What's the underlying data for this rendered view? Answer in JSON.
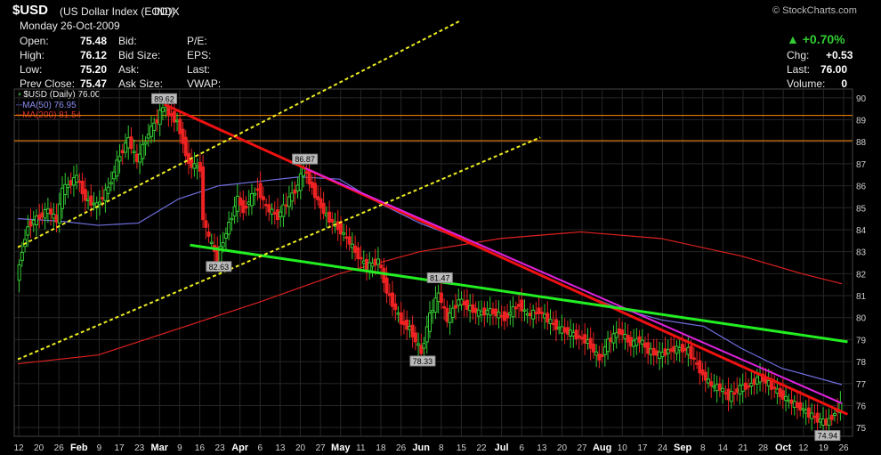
{
  "header": {
    "symbol": "$USD",
    "name": "(US Dollar Index (EOD))",
    "exchange": "INDX",
    "credit": "© StockCharts.com",
    "date": "Monday  26-Oct-2009",
    "open_label": "Open:",
    "open": "75.48",
    "high_label": "High:",
    "high": "76.12",
    "low_label": "Low:",
    "low": "75.20",
    "prevclose_label": "Prev Close:",
    "prevclose": "75.47",
    "bid_label": "Bid:",
    "bidsize_label": "Bid Size:",
    "ask_label": "Ask:",
    "asksize_label": "Ask Size:",
    "pe_label": "P/E:",
    "eps_label": "EPS:",
    "last_label": "Last:",
    "vwap_label": "VWAP:",
    "pct_change": "+0.70%",
    "chg_label": "Chg:",
    "chg": "+0.53",
    "last2_label": "Last:",
    "last2": "76.00",
    "volume_label": "Volume:",
    "volume": "0"
  },
  "legend": {
    "price": "$USD (Daily) 76.00",
    "ma50": "MA(50) 76.95",
    "ma200": "MA(200) 81.54"
  },
  "colors": {
    "up": "#33cc33",
    "down": "#ee2222",
    "ma50": "#6f6fe0",
    "ma200": "#dd2020",
    "grid": "#262626",
    "axis": "#cfcfcf",
    "trend_red": "#ee1111",
    "trend_magenta": "#dd22dd",
    "trend_green": "#22ee22",
    "trend_yellow": "#eeee22",
    "hline": "#ff8800"
  },
  "chart_data": {
    "type": "candlestick",
    "title": "$USD (US Dollar Index (EOD)) INDX",
    "xlabel": "",
    "ylabel": "",
    "ylim": [
      74.6,
      90.4
    ],
    "y_ticks": [
      75,
      76,
      77,
      78,
      79,
      80,
      81,
      82,
      83,
      84,
      85,
      86,
      87,
      88,
      89,
      90
    ],
    "x_ticks": [
      "12",
      "20",
      "26",
      "Feb",
      "9",
      "17",
      "23",
      "Mar",
      "9",
      "16",
      "23",
      "Apr",
      "6",
      "13",
      "20",
      "27",
      "May",
      "11",
      "18",
      "26",
      "Jun",
      "8",
      "15",
      "22",
      "Jul",
      "6",
      "13",
      "20",
      "27",
      "Aug",
      "10",
      "17",
      "24",
      "Sep",
      "8",
      "14",
      "21",
      "28",
      "Oct",
      "12",
      "19",
      "26"
    ],
    "price_points": [
      [
        "Jan 12",
        81.7
      ],
      [
        "Jan 14",
        83.1
      ],
      [
        "Jan 16",
        84.2
      ],
      [
        "Jan 20",
        84.6
      ],
      [
        "Jan 23",
        84.9
      ],
      [
        "Jan 26",
        84.4
      ],
      [
        "Jan 28",
        85.8
      ],
      [
        "Feb 2",
        86.4
      ],
      [
        "Feb 5",
        85.4
      ],
      [
        "Feb 9",
        85.1
      ],
      [
        "Feb 13",
        85.9
      ],
      [
        "Feb 17",
        87.4
      ],
      [
        "Feb 20",
        88.1
      ],
      [
        "Feb 23",
        87.1
      ],
      [
        "Feb 27",
        88.4
      ],
      [
        "Mar 2",
        89.0
      ],
      [
        "Mar 4",
        89.6
      ],
      [
        "Mar 6",
        89.3
      ],
      [
        "Mar 9",
        88.9
      ],
      [
        "Mar 11",
        88.0
      ],
      [
        "Mar 13",
        87.0
      ],
      [
        "Mar 17",
        86.8
      ],
      [
        "Mar 18",
        84.5
      ],
      [
        "Mar 20",
        83.6
      ],
      [
        "Mar 23",
        82.7
      ],
      [
        "Mar 26",
        83.9
      ],
      [
        "Mar 30",
        85.4
      ],
      [
        "Apr 1",
        84.9
      ],
      [
        "Apr 6",
        85.9
      ],
      [
        "Apr 9",
        85.0
      ],
      [
        "Apr 13",
        84.6
      ],
      [
        "Apr 16",
        85.2
      ],
      [
        "Apr 20",
        86.0
      ],
      [
        "Apr 22",
        86.8
      ],
      [
        "Apr 24",
        86.2
      ],
      [
        "Apr 27",
        85.3
      ],
      [
        "Apr 30",
        84.6
      ],
      [
        "May 4",
        84.1
      ],
      [
        "May 7",
        83.6
      ],
      [
        "May 11",
        82.8
      ],
      [
        "May 14",
        82.3
      ],
      [
        "May 18",
        82.6
      ],
      [
        "May 21",
        81.2
      ],
      [
        "May 26",
        79.8
      ],
      [
        "May 29",
        79.5
      ],
      [
        "Jun 2",
        78.4
      ],
      [
        "Jun 5",
        80.1
      ],
      [
        "Jun 8",
        81.1
      ],
      [
        "Jun 11",
        79.9
      ],
      [
        "Jun 15",
        80.8
      ],
      [
        "Jun 18",
        80.5
      ],
      [
        "Jun 22",
        80.2
      ],
      [
        "Jun 26",
        80.3
      ],
      [
        "Jul 1",
        80.0
      ],
      [
        "Jul 6",
        80.6
      ],
      [
        "Jul 9",
        80.1
      ],
      [
        "Jul 13",
        80.3
      ],
      [
        "Jul 16",
        79.9
      ],
      [
        "Jul 20",
        79.5
      ],
      [
        "Jul 24",
        79.3
      ],
      [
        "Jul 27",
        79.1
      ],
      [
        "Jul 30",
        78.9
      ],
      [
        "Aug 3",
        78.1
      ],
      [
        "Aug 6",
        78.9
      ],
      [
        "Aug 10",
        79.4
      ],
      [
        "Aug 14",
        78.8
      ],
      [
        "Aug 17",
        79.0
      ],
      [
        "Aug 20",
        78.5
      ],
      [
        "Aug 24",
        78.3
      ],
      [
        "Aug 27",
        78.5
      ],
      [
        "Aug 31",
        78.6
      ],
      [
        "Sep 3",
        78.5
      ],
      [
        "Sep 8",
        77.4
      ],
      [
        "Sep 11",
        76.9
      ],
      [
        "Sep 14",
        76.8
      ],
      [
        "Sep 17",
        76.4
      ],
      [
        "Sep 21",
        76.8
      ],
      [
        "Sep 24",
        76.9
      ],
      [
        "Sep 28",
        77.3
      ],
      [
        "Oct 1",
        77.0
      ],
      [
        "Oct 5",
        76.5
      ],
      [
        "Oct 8",
        76.2
      ],
      [
        "Oct 12",
        75.9
      ],
      [
        "Oct 15",
        75.6
      ],
      [
        "Oct 19",
        75.3
      ],
      [
        "Oct 21",
        75.2
      ],
      [
        "Oct 23",
        75.5
      ],
      [
        "Oct 26",
        76.0
      ]
    ],
    "ma50": [
      [
        "Jan 12",
        84.5
      ],
      [
        "Jan 26",
        84.4
      ],
      [
        "Feb 9",
        84.2
      ],
      [
        "Feb 23",
        84.3
      ],
      [
        "Mar 9",
        85.4
      ],
      [
        "Mar 23",
        86.0
      ],
      [
        "Apr 6",
        86.2
      ],
      [
        "Apr 20",
        86.4
      ],
      [
        "May 4",
        86.3
      ],
      [
        "May 18",
        85.2
      ],
      [
        "Jun 1",
        84.3
      ],
      [
        "Jun 15",
        83.6
      ],
      [
        "Jun 29",
        82.8
      ],
      [
        "Jul 13",
        81.9
      ],
      [
        "Jul 27",
        81.1
      ],
      [
        "Aug 10",
        80.4
      ],
      [
        "Aug 24",
        79.9
      ],
      [
        "Sep 8",
        79.6
      ],
      [
        "Sep 21",
        78.6
      ],
      [
        "Oct 5",
        77.7
      ],
      [
        "Oct 26",
        76.95
      ]
    ],
    "ma200": [
      [
        "Jan 12",
        77.9
      ],
      [
        "Feb 9",
        78.3
      ],
      [
        "Mar 9",
        79.5
      ],
      [
        "Apr 6",
        80.7
      ],
      [
        "May 4",
        82.0
      ],
      [
        "Jun 1",
        83.0
      ],
      [
        "Jun 29",
        83.6
      ],
      [
        "Jul 27",
        83.9
      ],
      [
        "Aug 24",
        83.6
      ],
      [
        "Sep 21",
        82.8
      ],
      [
        "Oct 12",
        82.0
      ],
      [
        "Oct 26",
        81.54
      ]
    ],
    "annotations": [
      {
        "label": "89.62",
        "date": "Mar 4",
        "value": 89.62
      },
      {
        "label": "86.87",
        "date": "Apr 22",
        "value": 86.87
      },
      {
        "label": "82.63",
        "date": "Mar 23",
        "value": 82.63
      },
      {
        "label": "81.47",
        "date": "Jun 8",
        "value": 81.47
      },
      {
        "label": "78.33",
        "date": "Jun 2",
        "value": 78.33
      },
      {
        "label": "74.94",
        "date": "Oct 21",
        "value": 74.94
      }
    ],
    "hlines": [
      89.2,
      88.05
    ],
    "trendlines": [
      {
        "color": "red",
        "from": [
          "Mar 4",
          89.7
        ],
        "to": [
          "Oct 26+",
          75.6
        ]
      },
      {
        "color": "magenta",
        "from": [
          "Apr 22",
          86.8
        ],
        "to": [
          "Oct 26",
          76.1
        ]
      },
      {
        "color": "green",
        "from": [
          "Mar 13",
          83.3
        ],
        "to": [
          "Oct 26+",
          78.9
        ]
      },
      {
        "color": "yellow",
        "from": [
          "Jan 12",
          83.2
        ],
        "to": [
          "Jun 15",
          93.5
        ]
      },
      {
        "color": "yellow",
        "from": [
          "Jan 12",
          78.1
        ],
        "to": [
          "Jul 13",
          88.2
        ]
      }
    ]
  }
}
